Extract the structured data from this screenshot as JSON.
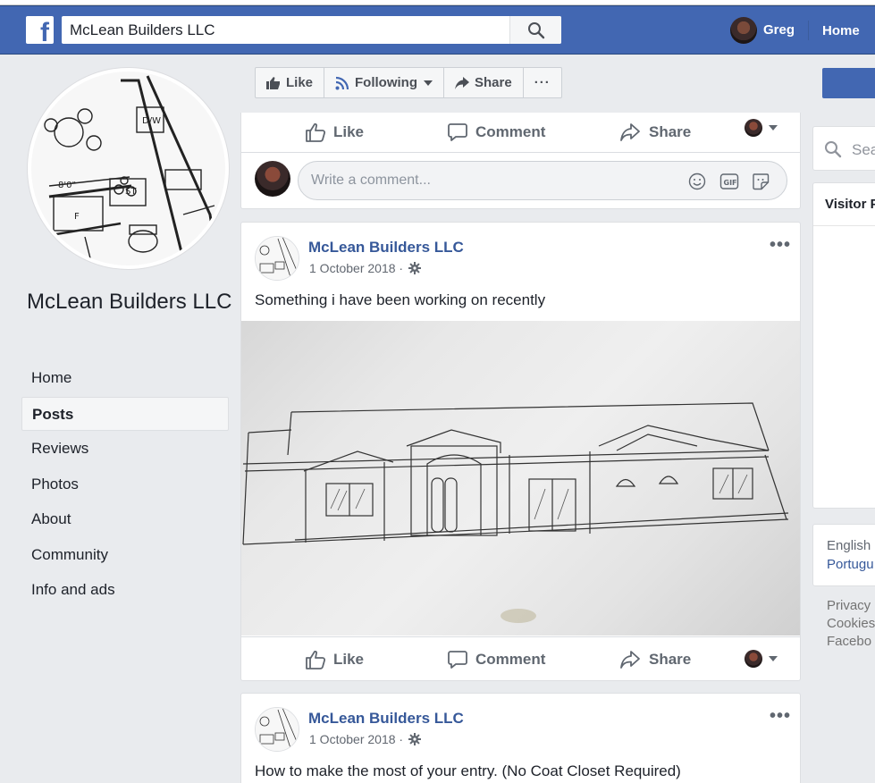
{
  "topbar": {
    "logo": "f",
    "search_value": "McLean Builders LLC",
    "user_name": "Greg",
    "home_label": "Home"
  },
  "page": {
    "name": "McLean Builders LLC",
    "nav": [
      {
        "label": "Home",
        "active": false
      },
      {
        "label": "Posts",
        "active": true
      },
      {
        "label": "Reviews",
        "active": false
      },
      {
        "label": "Photos",
        "active": false
      },
      {
        "label": "About",
        "active": false
      },
      {
        "label": "Community",
        "active": false
      },
      {
        "label": "Info and ads",
        "active": false
      }
    ]
  },
  "actionbar": {
    "like": "Like",
    "following": "Following",
    "share": "Share",
    "more": "···"
  },
  "reactions": {
    "like": "Like",
    "comment": "Comment",
    "share": "Share"
  },
  "comment_box": {
    "placeholder": "Write a comment..."
  },
  "posts": [
    {
      "author": "McLean Builders LLC",
      "date": "1 October 2018 ·",
      "text": "Something i have been working on recently"
    },
    {
      "author": "McLean Builders LLC",
      "date": "1 October 2018 ·",
      "text": "How to make the most of your entry. (No Coat Closet Required)"
    }
  ],
  "right": {
    "search_placeholder": "Sea",
    "visitor_title": "Visitor P",
    "lang_current": "English",
    "lang_alt": "Portugu",
    "footer": [
      "Privacy",
      "Cookies",
      "Facebo"
    ]
  },
  "colors": {
    "brand": "#4267b2",
    "link": "#365899",
    "background": "#e9ebee"
  }
}
